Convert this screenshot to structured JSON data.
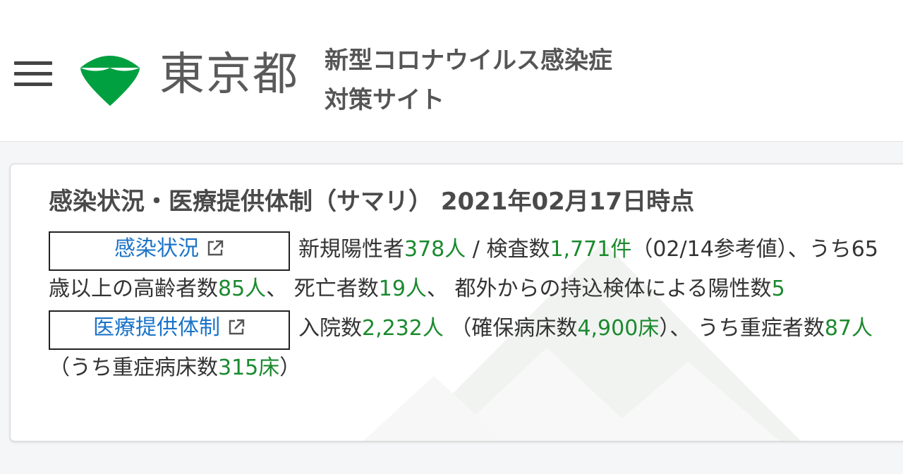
{
  "header": {
    "menu_icon": "hamburger-menu-icon",
    "logo_icon": "tokyo-ginkgo-logo-icon",
    "logo_text": "東京都",
    "site_title_line1": "新型コロナウイルス感染症",
    "site_title_line2": "対策サイト",
    "brand_color": "#00a040"
  },
  "card": {
    "title": "感染状況・医療提供体制（サマリ） 2021年02月17日時点",
    "infection_link_label": "感染状況",
    "medical_link_label": "医療提供体制",
    "external_link_icon": "external-link-icon",
    "infection": {
      "t1": "新規陽性者",
      "new_positive": "378人",
      "t2": " / 検査数",
      "tests": "1,771件",
      "t3": "（02/14参考値）、",
      "t4": "うち65歳以上の高齢者数",
      "elderly": "85人",
      "t5": "、 死亡者数",
      "deaths": "19人",
      "t6": "、 都外からの持込検体による陽性数",
      "outside": "5"
    },
    "medical": {
      "t1": "入院数",
      "hospitalized": "2,232人",
      "t2": " （確保病床数",
      "beds": "4,900床",
      "t3": "）、 うち重症者数",
      "severe": "87人",
      "t4": " （うち重症病床数",
      "severe_beds": "315床",
      "t5": "）"
    },
    "value_color": "#1b8a2e",
    "link_color": "#1a73c8"
  }
}
